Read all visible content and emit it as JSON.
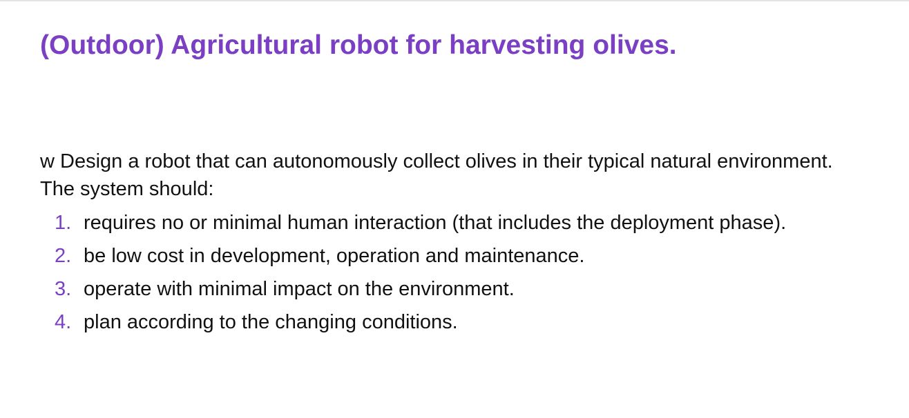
{
  "slide": {
    "title": "(Outdoor) Agricultural robot for harvesting olives.",
    "intro_line1": "w Design a robot that can autonomously collect olives in their typical natural environment.",
    "intro_line2": "The system should:",
    "items": [
      {
        "number": "1.",
        "text": "requires no or minimal human interaction (that includes the deployment phase)."
      },
      {
        "number": "2.",
        "text": "be low cost in development, operation and maintenance."
      },
      {
        "number": "3.",
        "text": "operate with minimal impact on the environment."
      },
      {
        "number": "4.",
        "text": "plan according to the changing conditions."
      }
    ]
  },
  "colors": {
    "title": "#7b3fc4",
    "list_numbers": "#7b3fc4",
    "body_text": "#111111",
    "background": "#ffffff"
  }
}
